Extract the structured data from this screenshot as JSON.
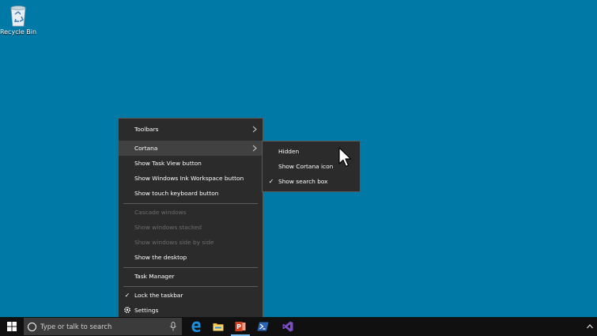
{
  "desktop": {
    "icons": [
      {
        "name": "recycle-bin",
        "label": "Recycle Bin"
      }
    ]
  },
  "context_menu": {
    "items": [
      {
        "label": "Toolbars",
        "submenu": true
      },
      {
        "label": "Cortana",
        "submenu": true,
        "highlighted": true
      },
      {
        "label": "Show Task View button"
      },
      {
        "label": "Show Windows Ink Workspace button"
      },
      {
        "label": "Show touch keyboard button"
      },
      {
        "label": "Cascade windows",
        "disabled": true
      },
      {
        "label": "Show windows stacked",
        "disabled": true
      },
      {
        "label": "Show windows side by side",
        "disabled": true
      },
      {
        "label": "Show the desktop"
      },
      {
        "label": "Task Manager"
      },
      {
        "label": "Lock the taskbar",
        "checked": true
      },
      {
        "label": "Settings",
        "icon": "gear-icon"
      }
    ]
  },
  "cortana_submenu": {
    "items": [
      {
        "label": "Hidden"
      },
      {
        "label": "Show Cortana icon"
      },
      {
        "label": "Show search box",
        "checked": true
      }
    ]
  },
  "taskbar": {
    "search_placeholder": "Type or talk to search",
    "apps": [
      {
        "name": "edge",
        "icon": "edge-icon"
      },
      {
        "name": "file-explorer",
        "icon": "folder-icon"
      },
      {
        "name": "powerpoint",
        "icon": "powerpoint-icon",
        "active": true
      },
      {
        "name": "powershell",
        "icon": "powershell-icon"
      },
      {
        "name": "visual-studio",
        "icon": "visual-studio-icon"
      }
    ]
  },
  "colors": {
    "desktop": "#0179a7",
    "menu_bg": "#2b2b2b",
    "menu_hover": "#414141",
    "taskbar": "#101010",
    "accent": "#76b9ed"
  }
}
